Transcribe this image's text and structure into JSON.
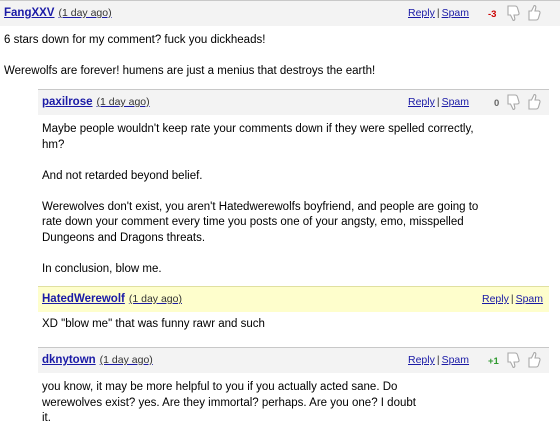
{
  "comments": [
    {
      "author": "FangXXV",
      "time": "(1 day ago)",
      "reply": "Reply",
      "separator": "|",
      "spam": "Spam",
      "score": "-3",
      "paragraphs": [
        "6 stars down for my comment? fuck you dickheads!",
        "Werewolfs are forever! humens are just a menius that destroys the earth!"
      ]
    },
    {
      "author": "paxilrose",
      "time": "(1 day ago)",
      "reply": "Reply",
      "separator": "|",
      "spam": "Spam",
      "score": "0",
      "paragraphs": [
        "Maybe people wouldn't keep rate your comments down if they were spelled correctly, hm?",
        "And not retarded beyond belief.",
        "Werewolves don't exist, you aren't Hatedwerewolfs boyfriend, and people are going to rate down your comment every time you posts one of your angsty, emo, misspelled Dungeons and Dragons threats.",
        "In conclusion, blow me."
      ]
    },
    {
      "author": "HatedWerewolf",
      "time": "(1 day ago)",
      "reply": "Reply",
      "separator": "|",
      "spam": "Spam",
      "paragraphs": [
        "XD \"blow me\" that was funny rawr and such"
      ]
    },
    {
      "author": "dknytown",
      "time": "(1 day ago)",
      "reply": "Reply",
      "separator": "|",
      "spam": "Spam",
      "score": "+1",
      "paragraphs": [
        "you know, it may be more helpful to you if you actually acted sane. Do werewolves exist? yes. Are they immortal? perhaps. Are you one? I doubt it."
      ]
    }
  ],
  "icons": {
    "thumb_down": "thumbs-down-icon",
    "thumb_up": "thumbs-up-icon"
  },
  "colors": {
    "link": "#1a1aa6",
    "header_bg": "#f3f3f3",
    "highlight_bg": "#fefecc",
    "score_negative": "#cc0000",
    "score_positive": "#2f9a2f",
    "score_zero": "#666666"
  }
}
